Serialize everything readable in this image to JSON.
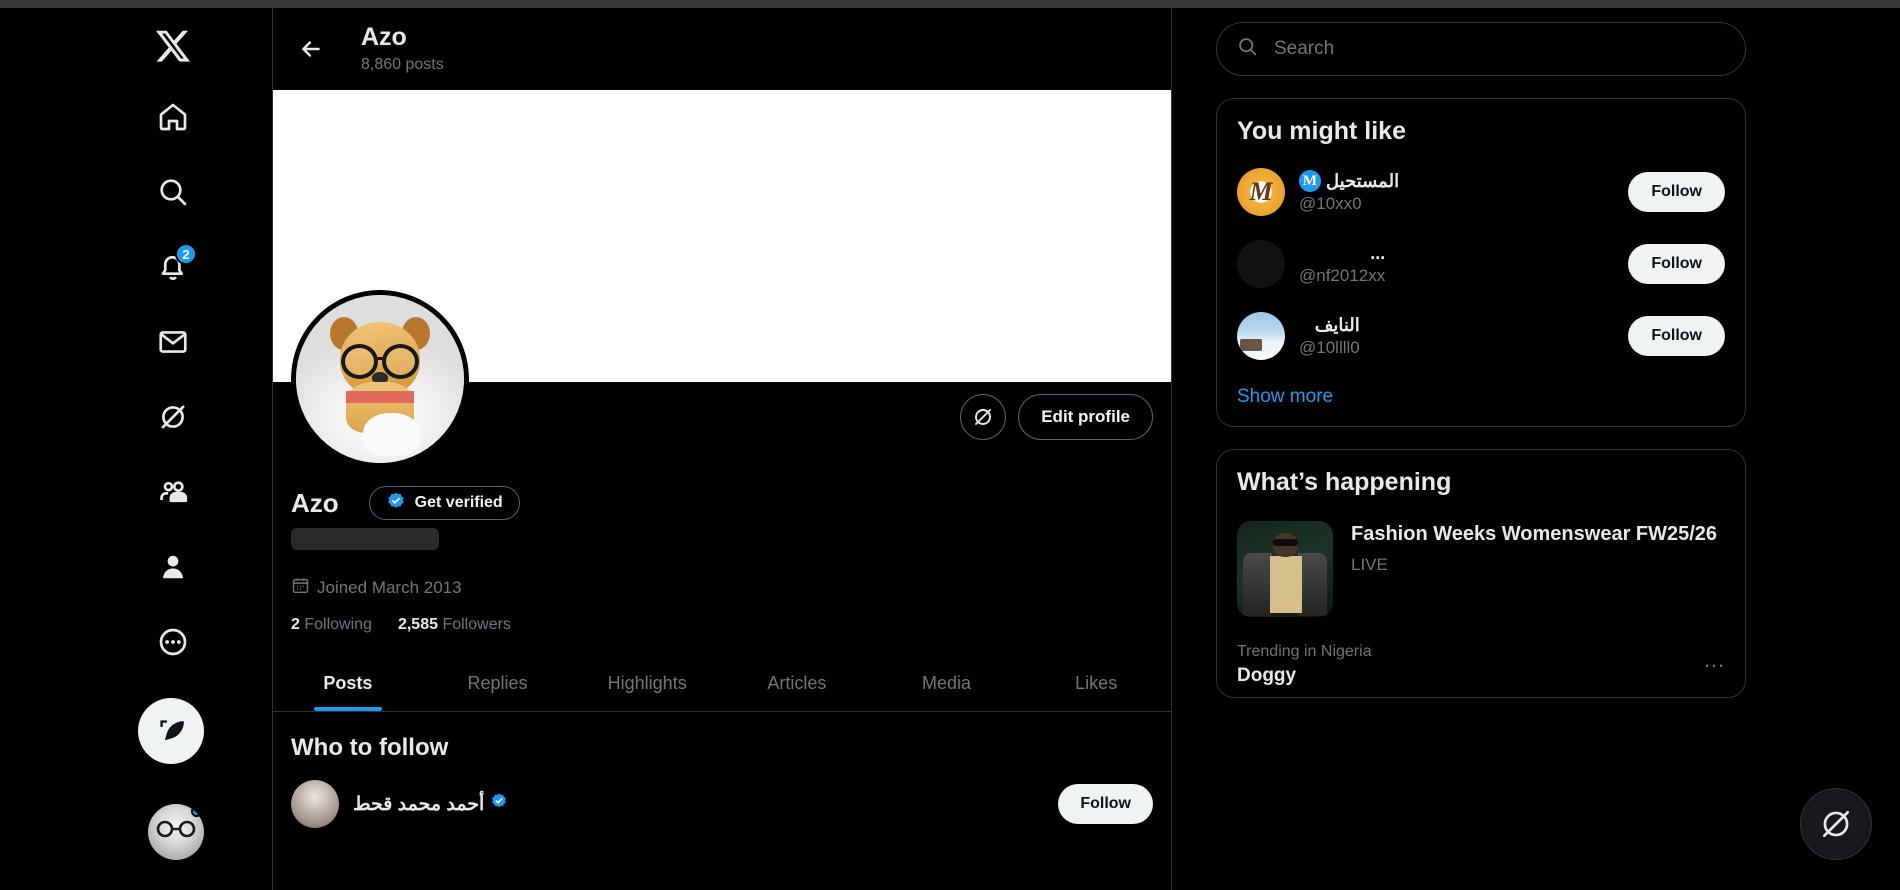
{
  "sidebar": {
    "items": [
      {
        "name": "x-logo",
        "label": "X"
      },
      {
        "name": "home",
        "label": "Home"
      },
      {
        "name": "explore",
        "label": "Search"
      },
      {
        "name": "notifications",
        "label": "Notifications",
        "badge": "2"
      },
      {
        "name": "messages",
        "label": "Messages"
      },
      {
        "name": "grok",
        "label": "Grok"
      },
      {
        "name": "communities",
        "label": "Communities"
      },
      {
        "name": "profile",
        "label": "Profile"
      },
      {
        "name": "more",
        "label": "More"
      }
    ],
    "compose_label": "Post"
  },
  "header": {
    "back_label": "Back",
    "title": "Azo",
    "posts_count": "8,860 posts"
  },
  "profile": {
    "display_name": "Azo",
    "get_verified_label": "Get verified",
    "edit_profile_label": "Edit profile",
    "joined": "Joined March 2013",
    "following_count": "2",
    "following_label": "Following",
    "followers_count": "2,585",
    "followers_label": "Followers",
    "tabs": [
      {
        "label": "Posts",
        "active": true
      },
      {
        "label": "Replies",
        "active": false
      },
      {
        "label": "Highlights",
        "active": false
      },
      {
        "label": "Articles",
        "active": false
      },
      {
        "label": "Media",
        "active": false
      },
      {
        "label": "Likes",
        "active": false
      }
    ],
    "who_to_follow_title": "Who to follow",
    "who_to_follow": [
      {
        "name": "أحمد محمد قحط",
        "follow_label": "Follow"
      }
    ]
  },
  "search": {
    "placeholder": "Search"
  },
  "you_might_like": {
    "title": "You might like",
    "show_more": "Show more",
    "accounts": [
      {
        "name": "المستحيل",
        "handle": "@10xx0",
        "verified_badge": "M",
        "follow_label": "Follow",
        "avatar": "mustaheel-logo"
      },
      {
        "name": "...",
        "handle": "@nf2012xx",
        "verified_badge": "",
        "follow_label": "Follow",
        "avatar": "dark-photo"
      },
      {
        "name": "النايف",
        "handle": "@10llll0",
        "verified_badge": "",
        "follow_label": "Follow",
        "avatar": "snow-photo"
      }
    ]
  },
  "whats_happening": {
    "title": "What’s happening",
    "live_item": {
      "title": "Fashion Weeks Womenswear FW25/26",
      "status": "LIVE"
    },
    "trends": [
      {
        "category": "Trending in Nigeria",
        "name": "Doggy",
        "more_label": "…"
      }
    ]
  },
  "colors": {
    "accent": "#1d9bf0",
    "background": "#000000",
    "text_primary": "#e7e9ea",
    "text_secondary": "#71767b",
    "border": "#2f3336"
  }
}
